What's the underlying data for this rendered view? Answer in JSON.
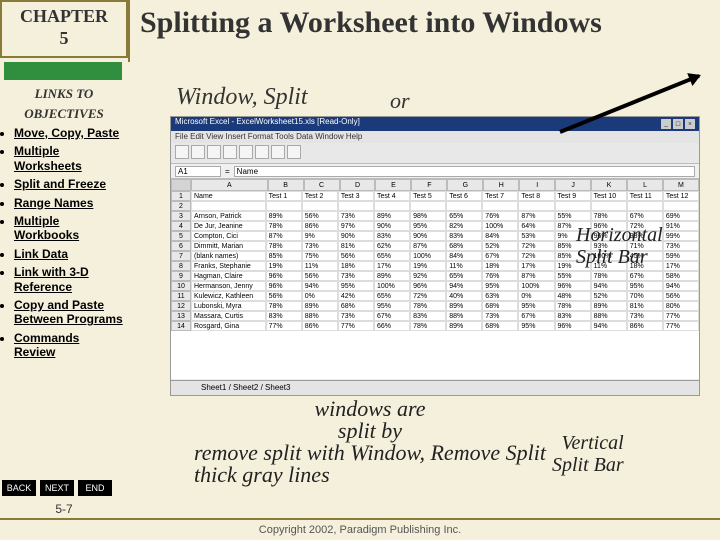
{
  "chapter": {
    "label": "CHAPTER",
    "number": "5"
  },
  "sidebar": {
    "links_to": "LINKS TO",
    "objectives": "OBJECTIVES",
    "items": [
      "Move, Copy, Paste",
      "Multiple Worksheets",
      "Split and Freeze",
      "Range Names",
      "Multiple Workbooks",
      "Link Data",
      "Link with 3-D Reference",
      "Copy and Paste Between Programs",
      "Commands Review"
    ]
  },
  "nav": {
    "back": "BACK",
    "next": "NEXT",
    "end": "END"
  },
  "page_num": "5-7",
  "title": "Splitting a Worksheet into Windows",
  "callouts": {
    "menu": "Window, Split",
    "or": "or",
    "horizontal": "Horizontal\nSplit Bar",
    "vertical": "Vertical\nSplit Bar",
    "body_l1": "windows are",
    "body_l2": "split by",
    "body_l3": "remove split with Window, Remove Split",
    "body_l4": "thick gray lines"
  },
  "excel": {
    "title_text": "Microsoft Excel - ExcelWorksheet15.xls [Read-Only]",
    "menu": "File  Edit  View  Insert  Format  Tools  Data  Window  Help",
    "cellref": "A1",
    "cellval": "Name",
    "cols": [
      "A",
      "B",
      "C",
      "D",
      "E",
      "F",
      "G",
      "H",
      "I",
      "J",
      "K",
      "L",
      "M"
    ],
    "header_row": [
      "Name",
      "Test 1",
      "Test 2",
      "Test 3",
      "Test 4",
      "Test 5",
      "Test 6",
      "Test 7",
      "Test 8",
      "Test 9",
      "Test 10",
      "Test 11",
      "Test 12"
    ],
    "rows": [
      [
        "Arnson, Patrick",
        "89%",
        "56%",
        "73%",
        "89%",
        "98%",
        "65%",
        "76%",
        "87%",
        "55%",
        "78%",
        "67%",
        "69%"
      ],
      [
        "De Jur, Jeanine",
        "78%",
        "86%",
        "97%",
        "90%",
        "95%",
        "82%",
        "100%",
        "64%",
        "87%",
        "96%",
        "72%",
        "91%"
      ],
      [
        "Compton, Cici",
        "87%",
        "9%",
        "90%",
        "83%",
        "90%",
        "83%",
        "84%",
        "53%",
        "9%",
        "96%",
        "98%",
        "99%"
      ],
      [
        "Dimmitt, Marian",
        "78%",
        "73%",
        "81%",
        "62%",
        "87%",
        "68%",
        "52%",
        "72%",
        "85%",
        "93%",
        "71%",
        "73%"
      ],
      [
        "(blank names)",
        "85%",
        "75%",
        "56%",
        "65%",
        "100%",
        "84%",
        "67%",
        "72%",
        "85%",
        "100%",
        "45%",
        "59%"
      ],
      [
        "Franks, Stephanie",
        "19%",
        "11%",
        "18%",
        "17%",
        "19%",
        "11%",
        "18%",
        "17%",
        "19%",
        "11%",
        "18%",
        "17%"
      ],
      [
        "Hagman, Claire",
        "96%",
        "56%",
        "73%",
        "89%",
        "92%",
        "65%",
        "76%",
        "87%",
        "55%",
        "78%",
        "67%",
        "58%"
      ],
      [
        "Hermanson, Jenny",
        "96%",
        "94%",
        "95%",
        "100%",
        "96%",
        "94%",
        "95%",
        "100%",
        "96%",
        "94%",
        "95%",
        "94%"
      ],
      [
        "Kulewicz, Kathleen",
        "56%",
        "0%",
        "42%",
        "65%",
        "72%",
        "40%",
        "63%",
        "0%",
        "48%",
        "52%",
        "70%",
        "56%"
      ],
      [
        "Lubonski, Myra",
        "78%",
        "89%",
        "68%",
        "95%",
        "78%",
        "89%",
        "68%",
        "95%",
        "78%",
        "89%",
        "81%",
        "80%"
      ],
      [
        "Massara, Curtis",
        "83%",
        "88%",
        "73%",
        "67%",
        "83%",
        "88%",
        "73%",
        "67%",
        "83%",
        "88%",
        "73%",
        "77%"
      ],
      [
        "Rosgard, Gina",
        "77%",
        "86%",
        "77%",
        "66%",
        "78%",
        "89%",
        "68%",
        "95%",
        "96%",
        "94%",
        "86%",
        "77%"
      ]
    ],
    "tabs": "Sheet1 / Sheet2 / Sheet3"
  },
  "copyright": "Copyright 2002, Paradigm Publishing Inc."
}
